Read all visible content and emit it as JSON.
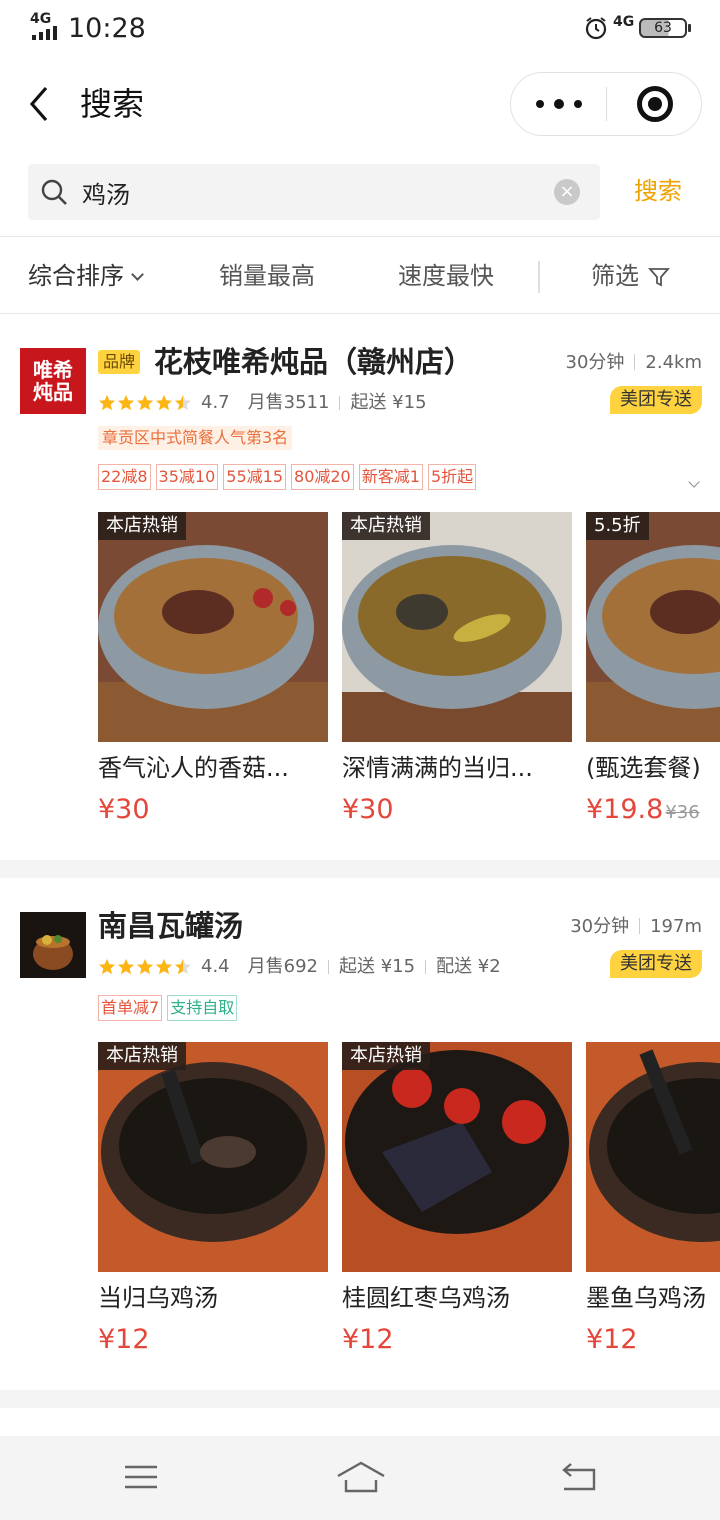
{
  "status_bar": {
    "network": "4G",
    "time": "10:28",
    "network_right": "4G",
    "battery": "63"
  },
  "nav": {
    "title": "搜索"
  },
  "search": {
    "value": "鸡汤",
    "button_label": "搜索"
  },
  "filters": {
    "sort": "综合排序",
    "sales": "销量最高",
    "speed": "速度最快",
    "screen": "筛选"
  },
  "stores": [
    {
      "brand_tag": "品牌",
      "name": "花枝唯希炖品（赣州店）",
      "logo_text": "唯希炖品",
      "delivery_time": "30分钟",
      "distance": "2.4km",
      "badge": "美团专送",
      "rating": "4.7",
      "monthly_sales": "月售3511",
      "min_order": "起送 ¥15",
      "rank": "章贡区中式简餐人气第3名",
      "promos": [
        "22减8",
        "35减10",
        "55减15",
        "80减20",
        "新客减1",
        "5折起"
      ],
      "dishes": [
        {
          "tag": "本店热销",
          "name": "香气沁人的香菇...",
          "price": "¥30",
          "orig": ""
        },
        {
          "tag": "本店热销",
          "name": "深情满满的当归...",
          "price": "¥30",
          "orig": ""
        },
        {
          "tag": "5.5折",
          "name": "(甄选套餐)",
          "price": "¥19.8",
          "orig": "¥36"
        }
      ]
    },
    {
      "brand_tag": "",
      "name": "南昌瓦罐汤",
      "delivery_time": "30分钟",
      "distance": "197m",
      "badge": "美团专送",
      "rating": "4.4",
      "monthly_sales": "月售692",
      "min_order": "起送 ¥15",
      "delivery_fee": "配送 ¥2",
      "promos": [
        "首单减7",
        "支持自取"
      ],
      "dishes": [
        {
          "tag": "本店热销",
          "name": "当归乌鸡汤",
          "price": "¥12"
        },
        {
          "tag": "本店热销",
          "name": "桂圆红枣乌鸡汤",
          "price": "¥12"
        },
        {
          "tag": "",
          "name": "墨鱼乌鸡汤",
          "price": "¥12"
        }
      ]
    }
  ]
}
